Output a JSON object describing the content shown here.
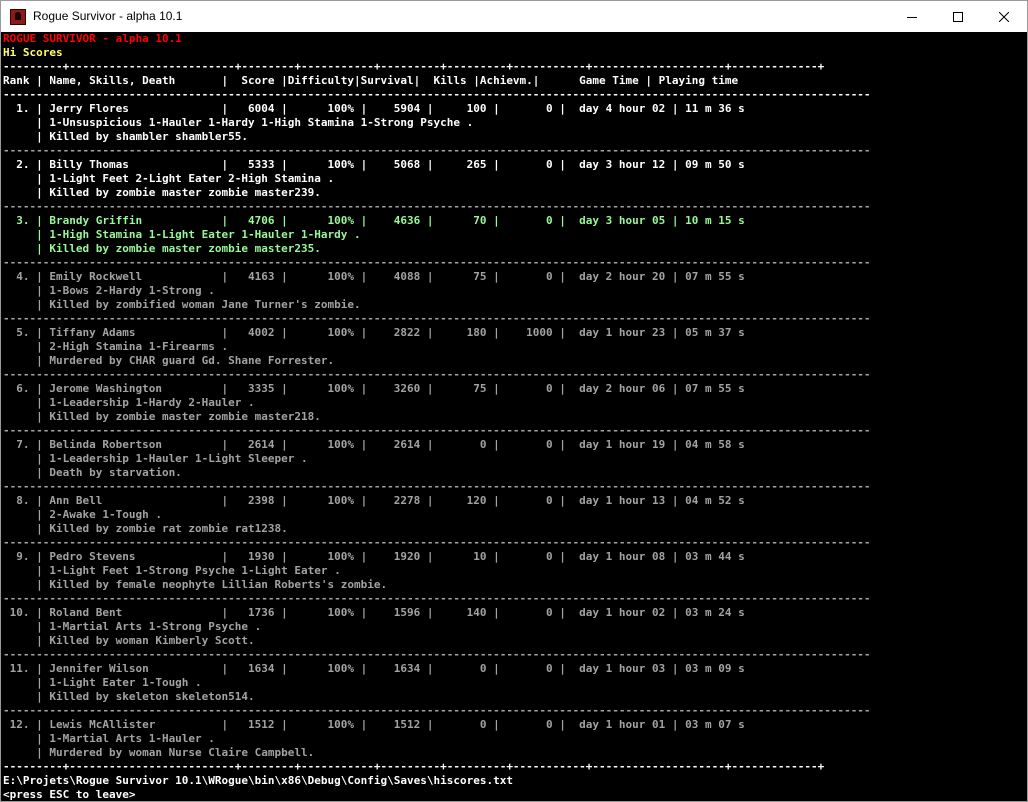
{
  "window": {
    "title": "Rogue Survivor - alpha 10.1",
    "icon": "rogue-survivor-app-icon",
    "controls": [
      "minimize-icon",
      "maximize-icon",
      "close-icon"
    ]
  },
  "console": {
    "game_title": "ROGUE SURVIVOR - alpha 10.1",
    "section_title": "Hi Scores",
    "separator_top": "---------+-------------------------+--------+-----------+---------+---------+-----------+--------------------+-------------+",
    "separator_header": "-----------------------------------------------------------------------------------------------------------------------------------",
    "header": "Rank | Name, Skills, Death       |  Score |Difficulty|Survival|  Kills |Achievm.|      Game Time | Playing time",
    "separator_row": "-----------------------------------------------------------------------------------------------------------------------------------",
    "separator_bottom": "---------+-------------------------+--------+-----------+---------+---------+-----------+--------------------+-------------+",
    "footer_path": "E:\\Projets\\Rogue Survivor 10.1\\WRogue\\bin\\x86\\Debug\\Config\\Saves\\hiscores.txt",
    "footer_hint": "<press ESC to leave>",
    "colors": {
      "title": "#ff0000",
      "section": "#ffff66",
      "header": "#ffffff",
      "top_entries": "#ffffff",
      "highlight_entry": "#98f898",
      "other_entries": "#a2a2a2"
    },
    "entries": [
      {
        "line1": "  1. | Jerry Flores              |   6004 |      100% |    5904 |     100 |       0 |  day 4 hour 02 | 11 m 36 s",
        "line2": "     | 1-Unsuspicious 1-Hauler 1-Hardy 1-High Stamina 1-Strong Psyche .",
        "line3": "     | Killed by shambler shambler55.",
        "style": "white"
      },
      {
        "line1": "  2. | Billy Thomas              |   5333 |      100% |    5068 |     265 |       0 |  day 3 hour 12 | 09 m 50 s",
        "line2": "     | 1-Light Feet 2-Light Eater 2-High Stamina .",
        "line3": "     | Killed by zombie master zombie master239.",
        "style": "white"
      },
      {
        "line1": "  3. | Brandy Griffin            |   4706 |      100% |    4636 |      70 |       0 |  day 3 hour 05 | 10 m 15 s",
        "line2": "     | 1-High Stamina 1-Light Eater 1-Hauler 1-Hardy .",
        "line3": "     | Killed by zombie master zombie master235.",
        "style": "green"
      },
      {
        "line1": "  4. | Emily Rockwell            |   4163 |      100% |    4088 |      75 |       0 |  day 2 hour 20 | 07 m 55 s",
        "line2": "     | 1-Bows 2-Hardy 1-Strong .",
        "line3": "     | Killed by zombified woman Jane Turner's zombie.",
        "style": "gray"
      },
      {
        "line1": "  5. | Tiffany Adams             |   4002 |      100% |    2822 |     180 |    1000 |  day 1 hour 23 | 05 m 37 s",
        "line2": "     | 2-High Stamina 1-Firearms .",
        "line3": "     | Murdered by CHAR guard Gd. Shane Forrester.",
        "style": "gray"
      },
      {
        "line1": "  6. | Jerome Washington         |   3335 |      100% |    3260 |      75 |       0 |  day 2 hour 06 | 07 m 55 s",
        "line2": "     | 1-Leadership 1-Hardy 2-Hauler .",
        "line3": "     | Killed by zombie master zombie master218.",
        "style": "gray"
      },
      {
        "line1": "  7. | Belinda Robertson         |   2614 |      100% |    2614 |       0 |       0 |  day 1 hour 19 | 04 m 58 s",
        "line2": "     | 1-Leadership 1-Hauler 1-Light Sleeper .",
        "line3": "     | Death by starvation.",
        "style": "gray"
      },
      {
        "line1": "  8. | Ann Bell                  |   2398 |      100% |    2278 |     120 |       0 |  day 1 hour 13 | 04 m 52 s",
        "line2": "     | 2-Awake 1-Tough .",
        "line3": "     | Killed by zombie rat zombie rat1238.",
        "style": "gray"
      },
      {
        "line1": "  9. | Pedro Stevens             |   1930 |      100% |    1920 |      10 |       0 |  day 1 hour 08 | 03 m 44 s",
        "line2": "     | 1-Light Feet 1-Strong Psyche 1-Light Eater .",
        "line3": "     | Killed by female neophyte Lillian Roberts's zombie.",
        "style": "gray"
      },
      {
        "line1": " 10. | Roland Bent               |   1736 |      100% |    1596 |     140 |       0 |  day 1 hour 02 | 03 m 24 s",
        "line2": "     | 1-Martial Arts 1-Strong Psyche .",
        "line3": "     | Killed by woman Kimberly Scott.",
        "style": "gray"
      },
      {
        "line1": " 11. | Jennifer Wilson           |   1634 |      100% |    1634 |       0 |       0 |  day 1 hour 03 | 03 m 09 s",
        "line2": "     | 1-Light Eater 1-Tough .",
        "line3": "     | Killed by skeleton skeleton514.",
        "style": "gray"
      },
      {
        "line1": " 12. | Lewis McAllister          |   1512 |      100% |    1512 |       0 |       0 |  day 1 hour 01 | 03 m 07 s",
        "line2": "     | 1-Martial Arts 1-Hauler .",
        "line3": "     | Murdered by woman Nurse Claire Campbell.",
        "style": "gray"
      }
    ]
  }
}
